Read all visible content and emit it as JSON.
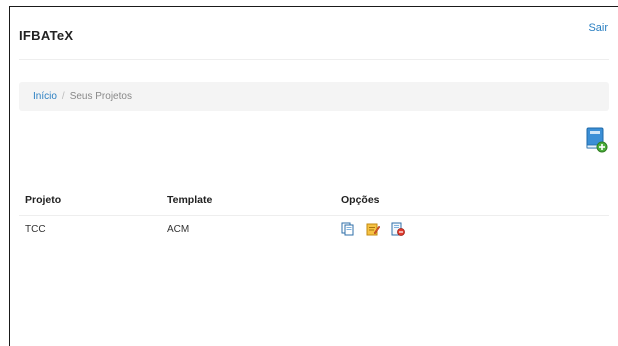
{
  "header": {
    "brand": "IFBATeX",
    "logout_label": "Sair"
  },
  "breadcrumb": {
    "home": "Início",
    "separator": "/",
    "current": "Seus Projetos"
  },
  "toolbar": {
    "new_project_icon": "book-add-icon"
  },
  "table": {
    "columns": [
      "Projeto",
      "Template",
      "Opções"
    ],
    "rows": [
      {
        "project": "TCC",
        "template": "ACM",
        "options": [
          "copy-document-icon",
          "edit-document-icon",
          "delete-document-icon"
        ]
      }
    ]
  },
  "colors": {
    "link": "#2a7fc2",
    "breadcrumb_bg": "#f4f4f4"
  }
}
